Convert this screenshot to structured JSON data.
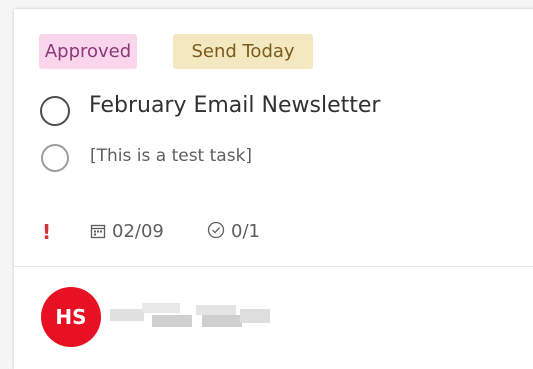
{
  "card": {
    "labels": [
      {
        "text": "Approved",
        "bg": "#f9d6ec",
        "fg": "#8a3a78"
      },
      {
        "text": "Send Today",
        "bg": "#f4e8c1",
        "fg": "#7b5a1a"
      }
    ],
    "task_title": "February Email Newsletter",
    "checklist_item": "[This is a test task]",
    "priority_symbol": "!",
    "due_date": "02/09",
    "checklist_progress": "0/1",
    "assignee": {
      "initials": "HS",
      "avatar_color": "#e81123"
    }
  },
  "icons": {
    "priority": "urgent-exclamation-icon",
    "due_date": "calendar-icon",
    "checklist": "check-circle-icon"
  },
  "colors": {
    "priority": "#d13438",
    "text_primary": "#323130",
    "text_secondary": "#605e5c"
  }
}
